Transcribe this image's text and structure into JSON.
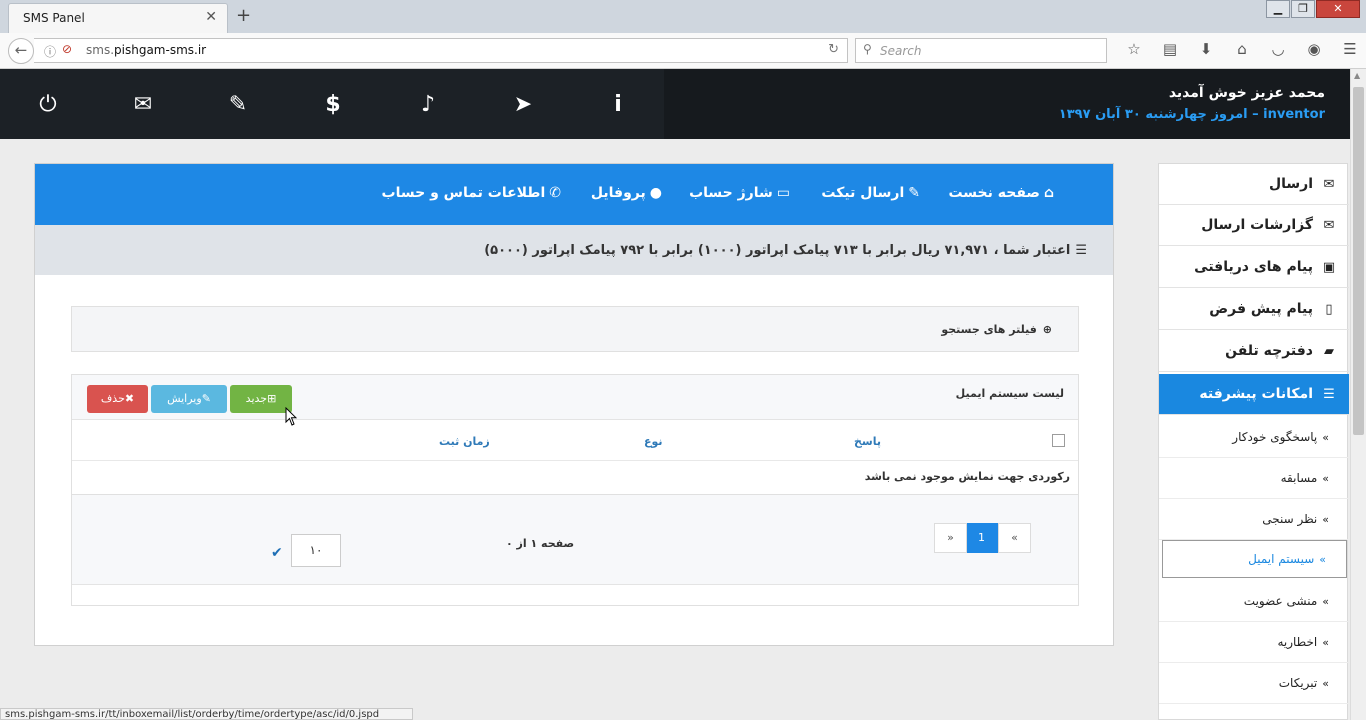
{
  "browser": {
    "tab_title": "SMS Panel",
    "tab_close": "✕",
    "new_tab": "+",
    "url_prefix": "sms.",
    "url_domain": "pishgam-sms.ir",
    "search_placeholder": "Search",
    "window_buttons": [
      "▁",
      "❐",
      "✕"
    ]
  },
  "header": {
    "welcome": "محمد عزیز خوش آمدید",
    "username": "inventor",
    "separator": " – ",
    "date": "امروز چهارشنبه ۳۰ آبان ۱۳۹۷"
  },
  "header_icons": [
    "power-icon",
    "envelope-icon",
    "ticket-icon",
    "dollar-icon",
    "bell-icon",
    "paper-plane-icon",
    "info-icon"
  ],
  "top_nav": {
    "home": "صفحه نخست",
    "ticket": "ارسال تیکت",
    "charge": "شارژ حساب",
    "profile": "پروفایل",
    "contact": "اطلاعات تماس و حساب"
  },
  "credit_text": "اعتبار شما ، ۷۱,۹۷۱ ریال برابر با ۷۱۳ پیامک اپراتور (۱۰۰۰) برابر با ۷۹۲ پیامک اپراتور (۵۰۰۰)",
  "filter": {
    "label": "فیلتر های جستجو"
  },
  "list": {
    "title": "لیست سیستم ایمیل",
    "btn_new": "جدید",
    "btn_edit": "ویرایش",
    "btn_delete": "حذف",
    "columns": [
      "پاسخ",
      "نوع",
      "زمان ثبت"
    ],
    "empty_message": "رکوردی جهت نمایش موجود نمی باشد",
    "pager": {
      "prev": "«",
      "current": "1",
      "next": "»"
    },
    "page_info": "صفحه ۱ از ۰",
    "page_size": "۱۰"
  },
  "sidebar": {
    "items": [
      {
        "label": "ارسال",
        "icon": "envelope-icon"
      },
      {
        "label": "گزارشات ارسال",
        "icon": "envelope-open-icon"
      },
      {
        "label": "پیام های دریافتی",
        "icon": "inbox-icon"
      },
      {
        "label": "پیام پیش فرض",
        "icon": "file-icon"
      },
      {
        "label": "دفترچه تلفن",
        "icon": "book-icon"
      },
      {
        "label": "امکانات پیشرفته",
        "icon": "list-icon"
      }
    ],
    "sub_items": [
      "پاسخگوی خودکار",
      "مسابقه",
      "نظر سنجی",
      "سیستم ایمیل",
      "منشی عضویت",
      "اخطاریه",
      "تبریکات"
    ]
  },
  "status_url": "sms.pishgam-sms.ir/tt/inboxemail/list/orderby/time/ordertype/asc/id/0.jspd"
}
